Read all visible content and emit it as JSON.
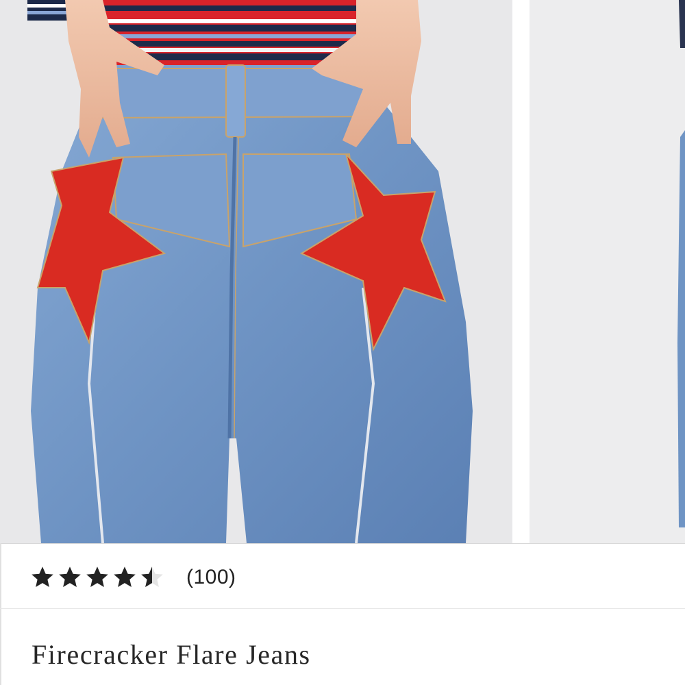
{
  "product": {
    "name": "Firecracker Flare Jeans",
    "rating": 4.5,
    "rating_max": 5,
    "review_count_label": "(100)"
  },
  "carousel": {
    "images": [
      {
        "icon": "denim-back-view-photo"
      },
      {
        "icon": "denim-side-view-photo"
      }
    ]
  },
  "colors": {
    "denim": "#6f94c4",
    "denim_dark": "#4f73a6",
    "star_patch": "#d92b22",
    "star_fill": "#222222",
    "text": "#262626",
    "background": "#ffffff"
  }
}
